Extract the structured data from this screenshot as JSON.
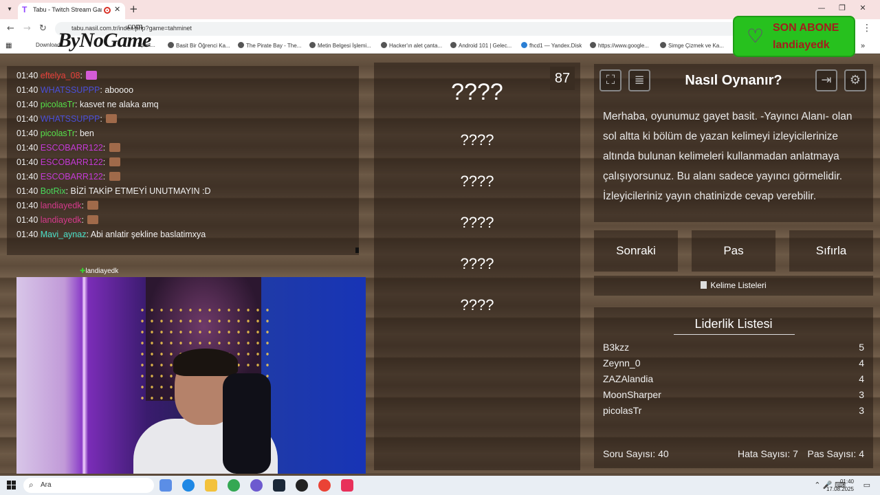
{
  "browser": {
    "tab_title": "Tabu - Twitch Stream Game",
    "url": "tabu.nasil.com.tr/index.php?game=tahminet",
    "bookmarks": [
      "Download",
      "Sport...",
      "Basit Bir Öğrenci Ka...",
      "The Pirate Bay - The...",
      "Metin Belgesi İşlemi...",
      "Hacker'ın alet çanta...",
      "Android 101 | Gelec...",
      "fhcd1 — Yandex.Disk",
      "https://www.google...",
      "Simge Çizmek ve Ka..."
    ]
  },
  "logo": {
    "main": "ByNoGame",
    "suffix": ".com"
  },
  "sub_alert": {
    "title": "SON ABONE",
    "name": "landiayedk",
    "color": "#27c11e"
  },
  "chat": [
    {
      "time": "01:40",
      "user": "eftelya_08",
      "color": "#e8403a",
      "text": "",
      "emote": "pink"
    },
    {
      "time": "01:40",
      "user": "WHATSSUPPP",
      "color": "#4a4fd8",
      "text": "aboooo",
      "emote": ""
    },
    {
      "time": "01:40",
      "user": "picolasTr",
      "color": "#56e04a",
      "text": "kasvet ne alaka amq",
      "emote": ""
    },
    {
      "time": "01:40",
      "user": "WHATSSUPPP",
      "color": "#4a4fd8",
      "text": "",
      "emote": "brown"
    },
    {
      "time": "01:40",
      "user": "picolasTr",
      "color": "#56e04a",
      "text": "ben",
      "emote": ""
    },
    {
      "time": "01:40",
      "user": "ESCOBARR122",
      "color": "#c43ad6",
      "text": "",
      "emote": "brown"
    },
    {
      "time": "01:40",
      "user": "ESCOBARR122",
      "color": "#c43ad6",
      "text": "",
      "emote": "brown"
    },
    {
      "time": "01:40",
      "user": "ESCOBARR122",
      "color": "#c43ad6",
      "text": "",
      "emote": "brown"
    },
    {
      "time": "01:40",
      "user": "BotRix",
      "color": "#4ad85c",
      "text": "BİZİ TAKİP ETMEYİ UNUTMAYIN :D",
      "emote": ""
    },
    {
      "time": "01:40",
      "user": "landiayedk",
      "color": "#d63a8c",
      "text": "",
      "emote": "brown"
    },
    {
      "time": "01:40",
      "user": "landiayedk",
      "color": "#d63a8c",
      "text": "",
      "emote": "brown"
    },
    {
      "time": "01:40",
      "user": "Mavi_aynaz",
      "color": "#4ae0c8",
      "text": "Abi anlatir şekline baslatimxya",
      "emote": ""
    }
  ],
  "overlay_name": "landiayedk",
  "game": {
    "timer": "87",
    "main_word": "????",
    "taboo_words": [
      "????",
      "????",
      "????",
      "????",
      "????"
    ]
  },
  "howto": {
    "title": "Nasıl Oynanır?",
    "text": "Merhaba, oyunumuz gayet basit. -Yayıncı Alanı- olan sol altta ki bölüm de yazan kelimeyi izleyicilerinize altında bulunan kelimeleri kullanmadan anlatmaya çalışıyorsunuz. Bu alanı sadece yayıncı görmelidir. İzleyicileriniz yayın chatinizde cevap verebilir."
  },
  "controls": {
    "next": "Sonraki",
    "pass": "Pas",
    "reset": "Sıfırla",
    "word_lists": "Kelime Listeleri"
  },
  "leaderboard": {
    "title": "Liderlik Listesi",
    "rows": [
      {
        "name": "B3kzz",
        "score": "5"
      },
      {
        "name": "Zeynn_0",
        "score": "4"
      },
      {
        "name": "ZAZAlandia",
        "score": "4"
      },
      {
        "name": "MoonSharper",
        "score": "3"
      },
      {
        "name": "picolasTr",
        "score": "3"
      }
    ],
    "stats": {
      "questions": "Soru Sayısı: 40",
      "errors": "Hata Sayısı: 7",
      "passes": "Pas Sayısı: 4"
    }
  },
  "taskbar": {
    "search": "Ara",
    "time": "01:40",
    "date": "17.08.2025"
  }
}
